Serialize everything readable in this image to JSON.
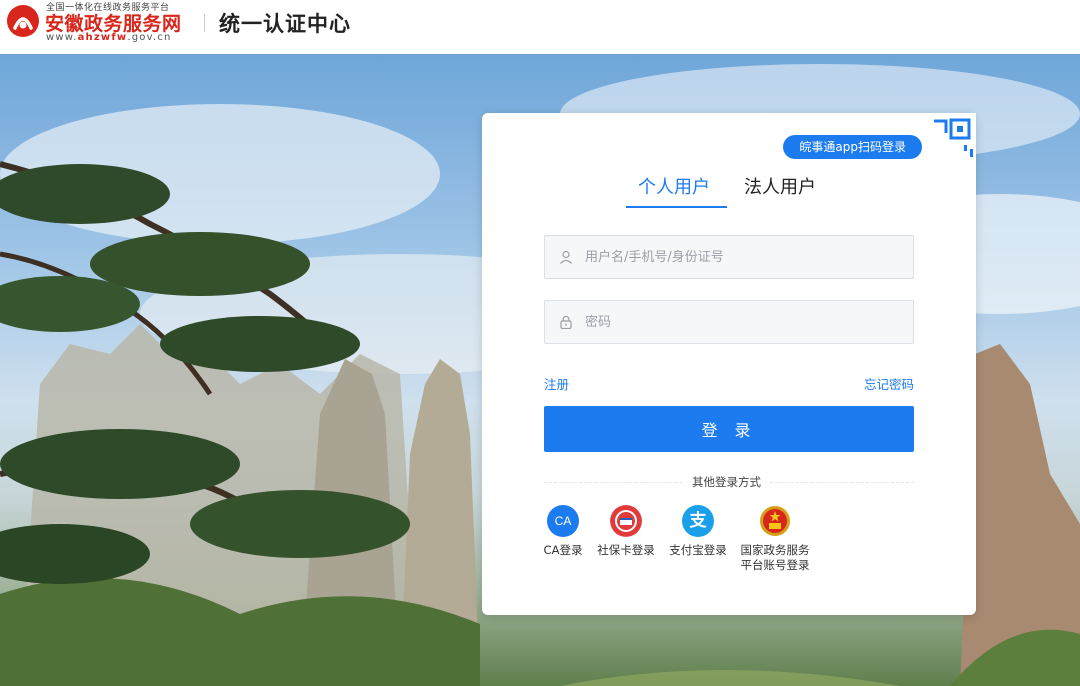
{
  "header": {
    "logo_tag": "全国一体化在线政务服务平台",
    "logo_name": "安徽政务服务网",
    "logo_url_prefix": "www.",
    "logo_url_highlight": "ahzwfw",
    "logo_url_suffix": ".gov.cn",
    "title": "统一认证中心"
  },
  "login": {
    "scan_badge": "皖事通app扫码登录",
    "tabs": [
      {
        "label": "个人用户",
        "active": true
      },
      {
        "label": "法人用户",
        "active": false
      }
    ],
    "username_placeholder": "用户名/手机号/身份证号",
    "password_placeholder": "密码",
    "register_link": "注册",
    "forgot_link": "忘记密码",
    "login_button": "登 录",
    "other_methods_label": "其他登录方式",
    "alt_methods": [
      {
        "label": "CA登录",
        "icon": "ca-icon",
        "icon_text": "CA"
      },
      {
        "label": "社保卡登录",
        "icon": "social-security-card-icon"
      },
      {
        "label": "支付宝登录",
        "icon": "alipay-icon",
        "icon_text": "支"
      },
      {
        "label_line1": "国家政务服务",
        "label_line2": "平台账号登录",
        "icon": "national-emblem-icon"
      }
    ]
  },
  "colors": {
    "accent": "#1d7bf0",
    "brand_red": "#d9261c",
    "alipay": "#1aa0e8"
  }
}
